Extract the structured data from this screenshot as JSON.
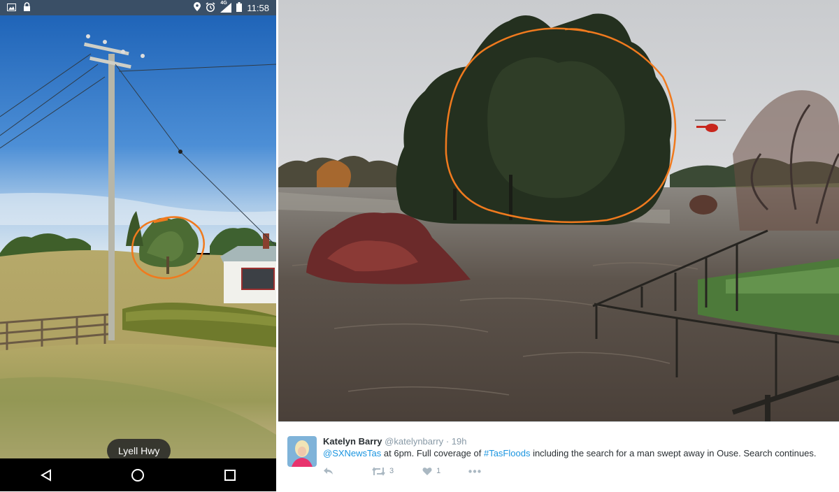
{
  "status_bar": {
    "time": "11:58",
    "network": "4G",
    "icons": [
      "image-icon",
      "lock-icon",
      "location-icon",
      "alarm-icon",
      "signal-icon",
      "battery-icon"
    ]
  },
  "street_view": {
    "street_label": "Lyell Hwy",
    "annotation_color": "#f07a1e"
  },
  "nav_bar": {
    "icons": [
      "back-icon",
      "home-icon",
      "recents-icon"
    ]
  },
  "tweet": {
    "author_name": "Katelyn Barry",
    "author_handle": "@katelynbarry",
    "separator": "·",
    "time_ago": "19h",
    "mention": "@SXNewsTas",
    "text_1": " at 6pm. Full coverage of ",
    "hashtag": "#TasFloods",
    "text_2": " including the search for a man swept away in Ouse. Search continues.",
    "retweet_count": "3",
    "like_count": "1",
    "link_color": "#1b95e0",
    "icons": [
      "reply-icon",
      "retweet-icon",
      "heart-icon",
      "more-icon"
    ]
  }
}
